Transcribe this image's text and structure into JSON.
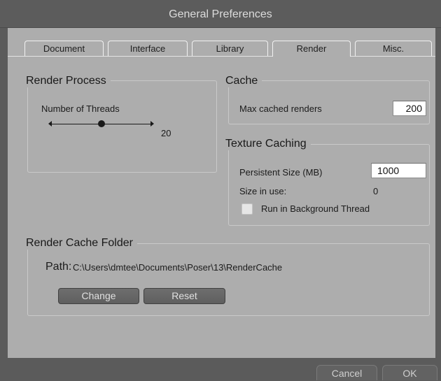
{
  "window": {
    "title": "General Preferences"
  },
  "tabs": [
    {
      "label": "Document"
    },
    {
      "label": "Interface"
    },
    {
      "label": "Library"
    },
    {
      "label": "Render",
      "active": true
    },
    {
      "label": "Misc."
    }
  ],
  "render_process": {
    "title": "Render Process",
    "threads_label": "Number of Threads",
    "threads_value": "20",
    "slider_level": 0.5
  },
  "cache": {
    "title": "Cache",
    "max_label": "Max cached renders",
    "max_value": "200"
  },
  "texture_caching": {
    "title": "Texture Caching",
    "persistent_label": "Persistent Size (MB)",
    "persistent_value": "1000",
    "in_use_label": "Size in use:",
    "in_use_value": "0",
    "background_label": "Run in Background Thread",
    "background_checked": false
  },
  "render_cache_folder": {
    "title": "Render Cache Folder",
    "path_label": "Path:",
    "path_value": "C:\\Users\\dmtee\\Documents\\Poser\\13\\RenderCache",
    "change_label": "Change",
    "reset_label": "Reset"
  },
  "footer": {
    "cancel_label": "Cancel",
    "ok_label": "OK"
  },
  "icons": {
    "slider_left": "triangle-left-icon",
    "slider_right": "triangle-right-icon",
    "slider_knob": "circle-knob-icon"
  },
  "colors": {
    "panel_bg": "#adadad",
    "titlebar_bg": "#5c5c5c",
    "button_bg": "#666666",
    "title_text": "#dcdcdc"
  }
}
